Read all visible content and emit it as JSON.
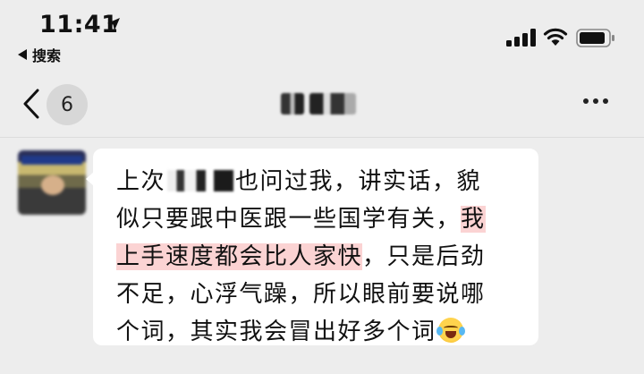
{
  "status_bar": {
    "time": "11:41",
    "back_app_label": "搜索"
  },
  "nav": {
    "unread_count": "6"
  },
  "message": {
    "line1_before": "上次",
    "line1_after": "也问过我，讲实话，貌",
    "line2_plain": "似只要跟中医跟一些国学有关，",
    "line2_highlight": "我",
    "line3_highlight": "上手速度都会比人家快",
    "line3_plain": "，只是后劲",
    "line4": "不足，心浮气躁，所以眼前要说哪",
    "line5": "个词，其实我会冒出好多个词"
  },
  "icons": {
    "location": "location-arrow-icon",
    "signal": "cellular-signal-icon",
    "wifi": "wifi-icon",
    "battery": "battery-icon",
    "back": "chevron-left-icon",
    "more": "more-dots-icon",
    "emoji": "crying-laughing-emoji-icon"
  },
  "colors": {
    "background": "#ededed",
    "bubble": "#ffffff",
    "highlight": "#fbd3d3"
  }
}
